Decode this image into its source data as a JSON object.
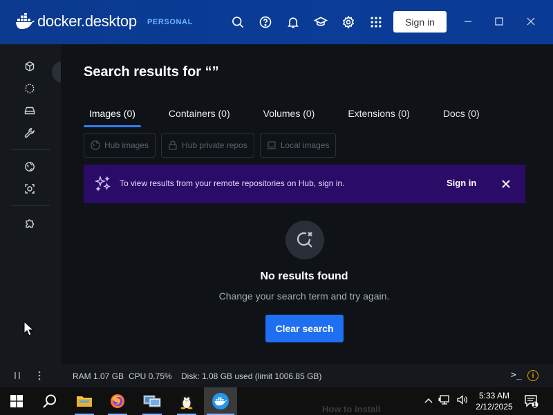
{
  "titlebar": {
    "brand": "docker desktop",
    "brand_docker": "docker",
    "brand_desktop": "desktop",
    "plan": "PERSONAL",
    "icons": [
      "search-icon",
      "help-icon",
      "bell-icon",
      "learn-icon",
      "gear-icon",
      "apps-grid-icon"
    ],
    "signin_label": "Sign in",
    "window_controls": [
      "minimize-icon",
      "maximize-icon",
      "close-icon"
    ]
  },
  "sidebar": {
    "items": [
      {
        "icon": "containers-icon"
      },
      {
        "icon": "images-icon"
      },
      {
        "icon": "volumes-icon"
      },
      {
        "icon": "builds-icon"
      },
      {
        "icon": "docker-hub-icon"
      },
      {
        "icon": "docker-scout-icon"
      },
      {
        "icon": "extensions-icon"
      }
    ]
  },
  "main": {
    "title": "Search results for “”",
    "tabs": [
      {
        "label": "Images (0)",
        "active": true
      },
      {
        "label": "Containers (0)",
        "active": false
      },
      {
        "label": "Volumes (0)",
        "active": false
      },
      {
        "label": "Extensions (0)",
        "active": false
      },
      {
        "label": "Docs (0)",
        "active": false
      }
    ],
    "filters": [
      {
        "label": "Hub images",
        "icon": "globe-icon"
      },
      {
        "label": "Hub private repos",
        "icon": "lock-icon"
      },
      {
        "label": "Local images",
        "icon": "laptop-icon"
      }
    ],
    "banner": {
      "message": "To view results from your remote repositories on Hub, sign in.",
      "action": "Sign in"
    },
    "empty": {
      "title": "No results found",
      "subtitle": "Change your search term and try again.",
      "button": "Clear search"
    }
  },
  "statusbar": {
    "ram": "RAM 1.07 GB",
    "cpu": "CPU 0.75%",
    "disk": "Disk: 1.08 GB used (limit 1006.85 GB)",
    "terminal_label": ">_",
    "warning": "i"
  },
  "taskbar": {
    "apps": [
      "windows-start-icon",
      "search-icon",
      "file-explorer-icon",
      "firefox-icon",
      "remote-desktop-icon",
      "linux-icon",
      "docker-icon"
    ],
    "ghost_text": "How to install",
    "time": "5:33 AM",
    "date": "2/12/2025",
    "notification_count": "1"
  },
  "colors": {
    "titlebar": "#0a3c98",
    "accent": "#1f6ff2",
    "banner": "#2a0b67",
    "background": "#0f1217"
  }
}
